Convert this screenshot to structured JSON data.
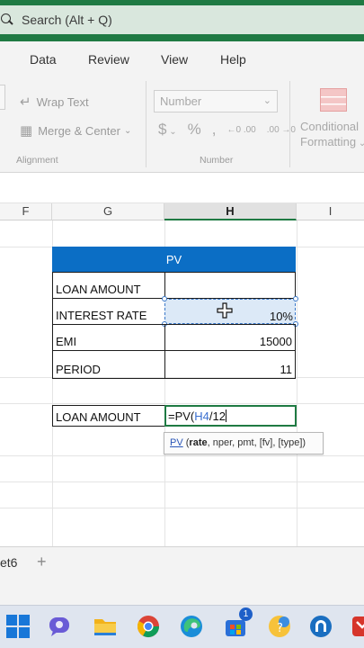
{
  "search": {
    "placeholder": "Search (Alt + Q)"
  },
  "ribbon": {
    "tabs": [
      "Data",
      "Review",
      "View",
      "Help"
    ],
    "alignment": {
      "wrap_text": "Wrap Text",
      "merge_center": "Merge & Center",
      "group_label": "Alignment"
    },
    "number": {
      "format_value": "Number",
      "group_label": "Number",
      "currency": "$",
      "percent": "%",
      "comma": ",",
      "dec_inc": "←0 .00",
      "dec_dec": ".00 →0"
    },
    "conditional": {
      "line1": "Conditional",
      "line2": "Formatting"
    }
  },
  "columns": [
    "F",
    "G",
    "H",
    "I"
  ],
  "table": {
    "header": "PV",
    "rows": [
      {
        "label": "LOAN AMOUNT",
        "value": ""
      },
      {
        "label": "INTEREST RATE",
        "value": "10%"
      },
      {
        "label": "EMI",
        "value": "15000"
      },
      {
        "label": "PERIOD",
        "value": "11"
      }
    ]
  },
  "result": {
    "label": "LOAN AMOUNT",
    "formula_prefix": "=PV(",
    "formula_ref": "H4",
    "formula_suffix": "/12"
  },
  "tooltip": {
    "fn": "PV",
    "open": " (",
    "current_arg": "rate",
    "rest": ", nper, pmt, [fv], [type])"
  },
  "sheet_tab": {
    "name": "et6",
    "add": "+"
  },
  "taskbar": {
    "store_badge": "1"
  }
}
